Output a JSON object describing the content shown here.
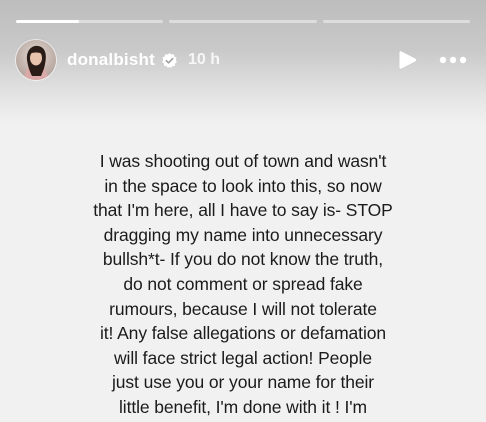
{
  "progress": {
    "segments": [
      {
        "fill": 0.43
      },
      {
        "fill": 0
      },
      {
        "fill": 0
      }
    ]
  },
  "header": {
    "username": "donalbisht",
    "timestamp": "10 h",
    "avatar_icon": "avatar-photo-icon",
    "verified_icon": "verified-badge-icon",
    "play_icon": "play-icon",
    "more_icon": "more-dots-icon"
  },
  "story": {
    "text": "I was shooting out of town and wasn't\nin the space to look into this, so now\nthat I'm here, all I have to say is- STOP\ndragging my name into unnecessary\nbullsh*t- If you do not know the truth,\ndo not comment or spread fake\nrumours, because I will not tolerate\nit! Any false allegations or defamation\nwill face strict legal action! People\njust use you or your name for their\nlittle benefit, I'm done with it ! I'm"
  },
  "colors": {
    "background": "#f1f1f1",
    "header_gradient_top": "#bdbdbd",
    "text": "#1b1b1b",
    "header_text": "#ffffff"
  }
}
